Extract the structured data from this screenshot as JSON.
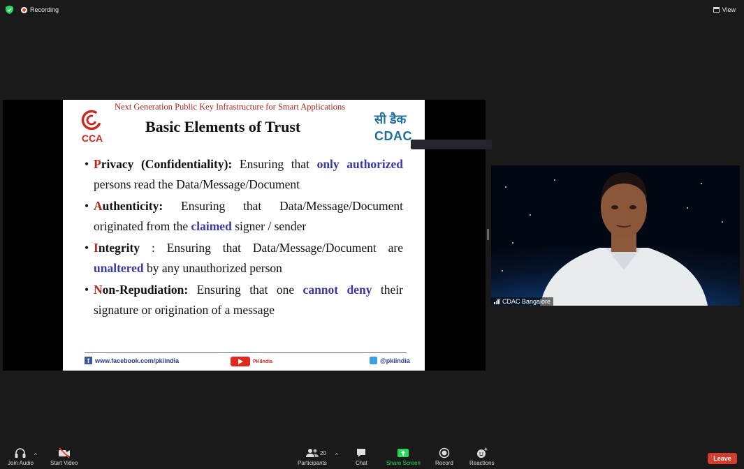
{
  "topbar": {
    "recording_label": "Recording",
    "view_label": "View"
  },
  "slide": {
    "header": "Next Generation Public Key Infrastructure for Smart Applications",
    "title": "Basic Elements of Trust",
    "logo_left_text": "CCA",
    "logo_right_hindi": "सी डैक",
    "logo_right_text": "CDAC",
    "bullets": [
      {
        "first_letter": "P",
        "term_rest": "rivacy (Confidentiality):",
        "t1": " Ensuring that ",
        "h1": "only authorized",
        "t2": " persons read the Data/Message/Document",
        "h2": "",
        "t3": ""
      },
      {
        "first_letter": "A",
        "term_rest": "uthenticity:",
        "t1": " Ensuring that Data/Message/Document originated from the ",
        "h1": "claimed",
        "t2": " signer / sender",
        "h2": "",
        "t3": ""
      },
      {
        "first_letter": "I",
        "term_rest": "ntegrity",
        "t1": " : Ensuring that Data/Message/Document are ",
        "h1": "unaltered",
        "t2": " by any unauthorized person",
        "h2": "",
        "t3": ""
      },
      {
        "first_letter": "N",
        "term_rest": "on-Repudiation:",
        "t1": " Ensuring that one ",
        "h1": "cannot deny",
        "t2": " their signature or origination of a message",
        "h2": "",
        "t3": ""
      }
    ],
    "footer": {
      "facebook": "www.facebook.com/pkiindia",
      "youtube": "PKIIndia",
      "twitter": "@pkiindia"
    }
  },
  "video": {
    "participant_name": "CDAC Bangalore"
  },
  "toolbar": {
    "join_audio": "Join Audio",
    "start_video": "Start Video",
    "participants": "Participants",
    "participant_count": "20",
    "chat": "Chat",
    "share_screen": "Share Screen",
    "record": "Record",
    "reactions": "Reactions",
    "leave": "Leave"
  },
  "colors": {
    "share_accent": "#23d959",
    "leave": "#d43c30",
    "slide_red": "#b4281e",
    "slide_blue": "#3a3aa6"
  },
  "icons": [
    "shield-icon",
    "recording-icon",
    "view-icon",
    "headphones-icon",
    "video-off-icon",
    "participants-icon",
    "chat-icon",
    "share-screen-icon",
    "record-icon",
    "reactions-icon",
    "signal-icon",
    "facebook-icon",
    "youtube-icon",
    "twitter-icon"
  ]
}
